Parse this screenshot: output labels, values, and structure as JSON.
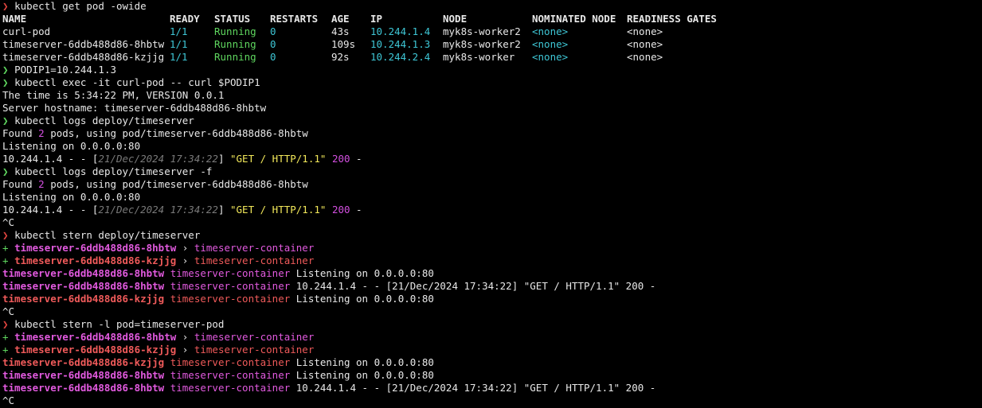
{
  "colors": {
    "background": "#000000",
    "text": "#e8e8e8",
    "prompt_red": "#e0443e",
    "prompt_green": "#5fd75f",
    "cyan": "#3ec7d6",
    "green": "#5fd75f",
    "magenta": "#d34fe0",
    "yellow": "#f2e85a",
    "dim": "#7a7a7a",
    "stern_pod_a": "#e25adf",
    "stern_pod_b": "#ef5a5a"
  },
  "prompt_symbol": "❯",
  "table": {
    "headers": [
      "NAME",
      "READY",
      "STATUS",
      "RESTARTS",
      "AGE",
      "IP",
      "NODE",
      "NOMINATED NODE",
      "READINESS GATES"
    ],
    "rows": [
      [
        "curl-pod",
        "1/1",
        "Running",
        "0",
        "43s",
        "10.244.1.4",
        "myk8s-worker2",
        "<none>",
        "<none>"
      ],
      [
        "timeserver-6ddb488d86-8hbtw",
        "1/1",
        "Running",
        "0",
        "109s",
        "10.244.1.3",
        "myk8s-worker2",
        "<none>",
        "<none>"
      ],
      [
        "timeserver-6ddb488d86-kzjjg",
        "1/1",
        "Running",
        "0",
        "92s",
        "10.244.2.4",
        "myk8s-worker",
        "<none>",
        "<none>"
      ]
    ]
  },
  "lines": [
    {
      "kind": "cmd",
      "prompt": "red",
      "segments": [
        {
          "t": "kubectl get pod -owide"
        }
      ]
    },
    {
      "kind": "table-header"
    },
    {
      "kind": "table-row",
      "row": 0
    },
    {
      "kind": "table-row",
      "row": 1
    },
    {
      "kind": "table-row",
      "row": 2
    },
    {
      "kind": "cmd",
      "prompt": "green",
      "segments": [
        {
          "t": "PODIP1=10.244.1.3"
        }
      ]
    },
    {
      "kind": "cmd",
      "prompt": "green",
      "segments": [
        {
          "t": "kubectl exec -it curl-pod -- curl $PODIP1"
        }
      ]
    },
    {
      "kind": "out",
      "segments": [
        {
          "t": "The time is 5:34:22 PM, VERSION 0.0.1"
        }
      ]
    },
    {
      "kind": "out",
      "segments": [
        {
          "t": "Server hostname: timeserver-6ddb488d86-8hbtw"
        }
      ]
    },
    {
      "kind": "cmd",
      "prompt": "green",
      "segments": [
        {
          "t": "kubectl logs deploy/timeserver"
        }
      ]
    },
    {
      "kind": "out",
      "segments": [
        {
          "t": "Found "
        },
        {
          "t": "2",
          "c": "magenta"
        },
        {
          "t": " pods, using pod/timeserver-6ddb488d86-8hbtw"
        }
      ]
    },
    {
      "kind": "out",
      "segments": [
        {
          "t": "Listening on 0.0.0.0:80"
        }
      ]
    },
    {
      "kind": "out",
      "segments": [
        {
          "t": "10.244.1.4 - - ["
        },
        {
          "t": "21/Dec/2024 17:34:22",
          "c": "dim",
          "i": true
        },
        {
          "t": "] "
        },
        {
          "t": "\"GET / HTTP/1.1\"",
          "c": "yellow"
        },
        {
          "t": " "
        },
        {
          "t": "200",
          "c": "magenta"
        },
        {
          "t": " -"
        }
      ]
    },
    {
      "kind": "cmd",
      "prompt": "green",
      "segments": [
        {
          "t": "kubectl logs deploy/timeserver -f"
        }
      ]
    },
    {
      "kind": "out",
      "segments": [
        {
          "t": "Found "
        },
        {
          "t": "2",
          "c": "magenta"
        },
        {
          "t": " pods, using pod/timeserver-6ddb488d86-8hbtw"
        }
      ]
    },
    {
      "kind": "out",
      "segments": [
        {
          "t": "Listening on 0.0.0.0:80"
        }
      ]
    },
    {
      "kind": "out",
      "segments": [
        {
          "t": "10.244.1.4 - - ["
        },
        {
          "t": "21/Dec/2024 17:34:22",
          "c": "dim",
          "i": true
        },
        {
          "t": "] "
        },
        {
          "t": "\"GET / HTTP/1.1\"",
          "c": "yellow"
        },
        {
          "t": " "
        },
        {
          "t": "200",
          "c": "magenta"
        },
        {
          "t": " -"
        }
      ]
    },
    {
      "kind": "out",
      "segments": [
        {
          "t": "^C"
        }
      ]
    },
    {
      "kind": "cmd",
      "prompt": "red",
      "segments": [
        {
          "t": "kubectl stern deploy/timeserver"
        }
      ]
    },
    {
      "kind": "out",
      "segments": [
        {
          "t": "+ ",
          "c": "green"
        },
        {
          "t": "timeserver-6ddb488d86-8hbtw",
          "c": "stern_pod_a",
          "b": true
        },
        {
          "t": " › "
        },
        {
          "t": "timeserver-container",
          "c": "stern_pod_a"
        }
      ]
    },
    {
      "kind": "out",
      "segments": [
        {
          "t": "+ ",
          "c": "green"
        },
        {
          "t": "timeserver-6ddb488d86-kzjjg",
          "c": "stern_pod_b",
          "b": true
        },
        {
          "t": " › "
        },
        {
          "t": "timeserver-container",
          "c": "stern_pod_b"
        }
      ]
    },
    {
      "kind": "out",
      "segments": [
        {
          "t": "timeserver-6ddb488d86-8hbtw",
          "c": "stern_pod_a",
          "b": true
        },
        {
          "t": " "
        },
        {
          "t": "timeserver-container",
          "c": "stern_pod_a"
        },
        {
          "t": " Listening on 0.0.0.0:80"
        }
      ]
    },
    {
      "kind": "out",
      "segments": [
        {
          "t": "timeserver-6ddb488d86-8hbtw",
          "c": "stern_pod_a",
          "b": true
        },
        {
          "t": " "
        },
        {
          "t": "timeserver-container",
          "c": "stern_pod_a"
        },
        {
          "t": " 10.244.1.4 - - [21/Dec/2024 17:34:22] \"GET / HTTP/1.1\" 200 -"
        }
      ]
    },
    {
      "kind": "out",
      "segments": [
        {
          "t": "timeserver-6ddb488d86-kzjjg",
          "c": "stern_pod_b",
          "b": true
        },
        {
          "t": " "
        },
        {
          "t": "timeserver-container",
          "c": "stern_pod_b"
        },
        {
          "t": " Listening on 0.0.0.0:80"
        }
      ]
    },
    {
      "kind": "out",
      "segments": [
        {
          "t": "^C"
        }
      ]
    },
    {
      "kind": "cmd",
      "prompt": "red",
      "segments": [
        {
          "t": "kubectl stern -l pod=timeserver-pod"
        }
      ]
    },
    {
      "kind": "out",
      "segments": [
        {
          "t": "+ ",
          "c": "green"
        },
        {
          "t": "timeserver-6ddb488d86-8hbtw",
          "c": "stern_pod_a",
          "b": true
        },
        {
          "t": " › "
        },
        {
          "t": "timeserver-container",
          "c": "stern_pod_a"
        }
      ]
    },
    {
      "kind": "out",
      "segments": [
        {
          "t": "+ ",
          "c": "green"
        },
        {
          "t": "timeserver-6ddb488d86-kzjjg",
          "c": "stern_pod_b",
          "b": true
        },
        {
          "t": " › "
        },
        {
          "t": "timeserver-container",
          "c": "stern_pod_b"
        }
      ]
    },
    {
      "kind": "out",
      "segments": [
        {
          "t": "timeserver-6ddb488d86-kzjjg",
          "c": "stern_pod_b",
          "b": true
        },
        {
          "t": " "
        },
        {
          "t": "timeserver-container",
          "c": "stern_pod_b"
        },
        {
          "t": " Listening on 0.0.0.0:80"
        }
      ]
    },
    {
      "kind": "out",
      "segments": [
        {
          "t": "timeserver-6ddb488d86-8hbtw",
          "c": "stern_pod_a",
          "b": true
        },
        {
          "t": " "
        },
        {
          "t": "timeserver-container",
          "c": "stern_pod_a"
        },
        {
          "t": " Listening on 0.0.0.0:80"
        }
      ]
    },
    {
      "kind": "out",
      "segments": [
        {
          "t": "timeserver-6ddb488d86-8hbtw",
          "c": "stern_pod_a",
          "b": true
        },
        {
          "t": " "
        },
        {
          "t": "timeserver-container",
          "c": "stern_pod_a"
        },
        {
          "t": " 10.244.1.4 - - [21/Dec/2024 17:34:22] \"GET / HTTP/1.1\" 200 -"
        }
      ]
    },
    {
      "kind": "out",
      "segments": [
        {
          "t": "^C"
        }
      ]
    }
  ]
}
